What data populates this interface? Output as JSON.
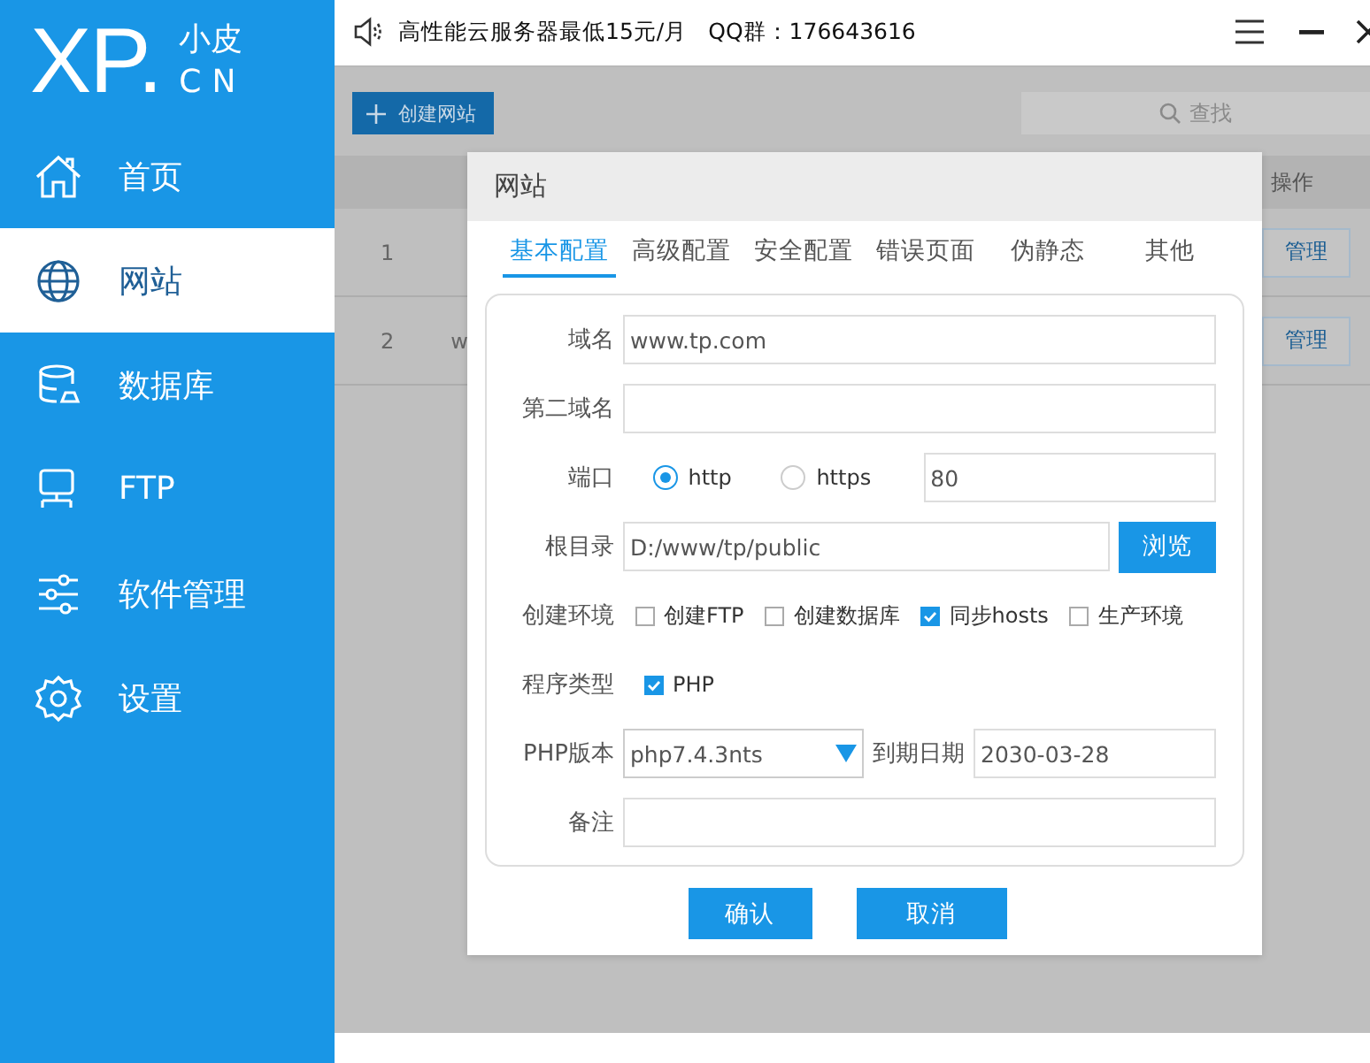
{
  "logo": {
    "mark": "XP.",
    "line1": "小皮",
    "line2": "CN"
  },
  "sidebar": {
    "items": [
      {
        "label": "首页",
        "kind": "home",
        "selected": false
      },
      {
        "label": "网站",
        "kind": "globe",
        "selected": true
      },
      {
        "label": "数据库",
        "kind": "database",
        "selected": false
      },
      {
        "label": "FTP",
        "kind": "monitor",
        "selected": false
      },
      {
        "label": "软件管理",
        "kind": "sliders",
        "selected": false
      },
      {
        "label": "设置",
        "kind": "gear",
        "selected": false
      }
    ]
  },
  "topbar": {
    "notice": "高性能云服务器最低15元/月",
    "qq": "QQ群：176643616"
  },
  "toolbar": {
    "create_button": "创建网站",
    "search": {
      "placeholder": "查找"
    }
  },
  "table": {
    "action_header": "操作",
    "rows": [
      {
        "index": "1",
        "action": "管理"
      },
      {
        "index": "2",
        "column_2": "w",
        "action": "管理"
      }
    ]
  },
  "dialog": {
    "title": "网站",
    "tabs": [
      {
        "label": "基本配置",
        "selected": true
      },
      {
        "label": "高级配置",
        "selected": false
      },
      {
        "label": "安全配置",
        "selected": false
      },
      {
        "label": "错误页面",
        "selected": false
      },
      {
        "label": "伪静态",
        "selected": false
      },
      {
        "label": "其他",
        "selected": false
      }
    ],
    "domain": {
      "label": "域名",
      "value": "www.tp.com"
    },
    "second_domain": {
      "label": "第二域名"
    },
    "port": {
      "label": "端口",
      "options": [
        {
          "label": "http",
          "selected": true
        },
        {
          "label": "https",
          "selected": false
        }
      ],
      "value": "80"
    },
    "root": {
      "label": "根目录",
      "value": "D:/www/tp/public",
      "button": "浏览"
    },
    "environment": {
      "label": "创建环境",
      "options": [
        {
          "label": "创建FTP",
          "checked": false
        },
        {
          "label": "创建数据库",
          "checked": false
        },
        {
          "label": "同步hosts",
          "checked": true
        },
        {
          "label": "生产环境",
          "checked": false
        }
      ]
    },
    "program_type": {
      "label": "程序类型",
      "options": [
        {
          "label": "PHP",
          "checked": true
        }
      ]
    },
    "php_version": {
      "label": "PHP版本",
      "value": "php7.4.3nts"
    },
    "expiry": {
      "label": "到期日期",
      "value": "2030-03-28"
    },
    "note": {
      "label": "备注"
    },
    "buttons": [
      {
        "label": "确认"
      },
      {
        "label": "取消"
      }
    ]
  }
}
